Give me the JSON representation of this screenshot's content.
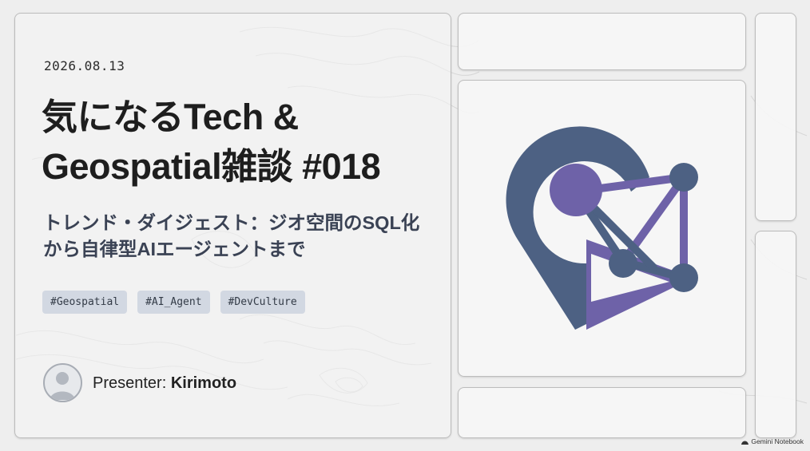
{
  "slide": {
    "date": "2026.08.13",
    "title": "気になるTech &\nGeospatial雑談 #018",
    "subtitle": "トレンド・ダイジェスト：ジオ空間のSQL化\nから自律型AIエージェントまで",
    "tags": [
      "#Geospatial",
      "#AI_Agent",
      "#DevCulture"
    ],
    "presenter_prefix": "Presenter: ",
    "presenter_name": "Kirimoto"
  },
  "logo": {
    "icon": "map-pin-network-icon",
    "colors": {
      "pin": "#4d6183",
      "node": "#6e62a8"
    }
  },
  "badge": {
    "label": "Gemini Notebook"
  },
  "colors": {
    "background": "#eeeeee",
    "title": "#1e1e1e",
    "subtitle": "#3a4254",
    "tag_bg": "#d2d8e2",
    "card_border": "#bcbcbc"
  }
}
